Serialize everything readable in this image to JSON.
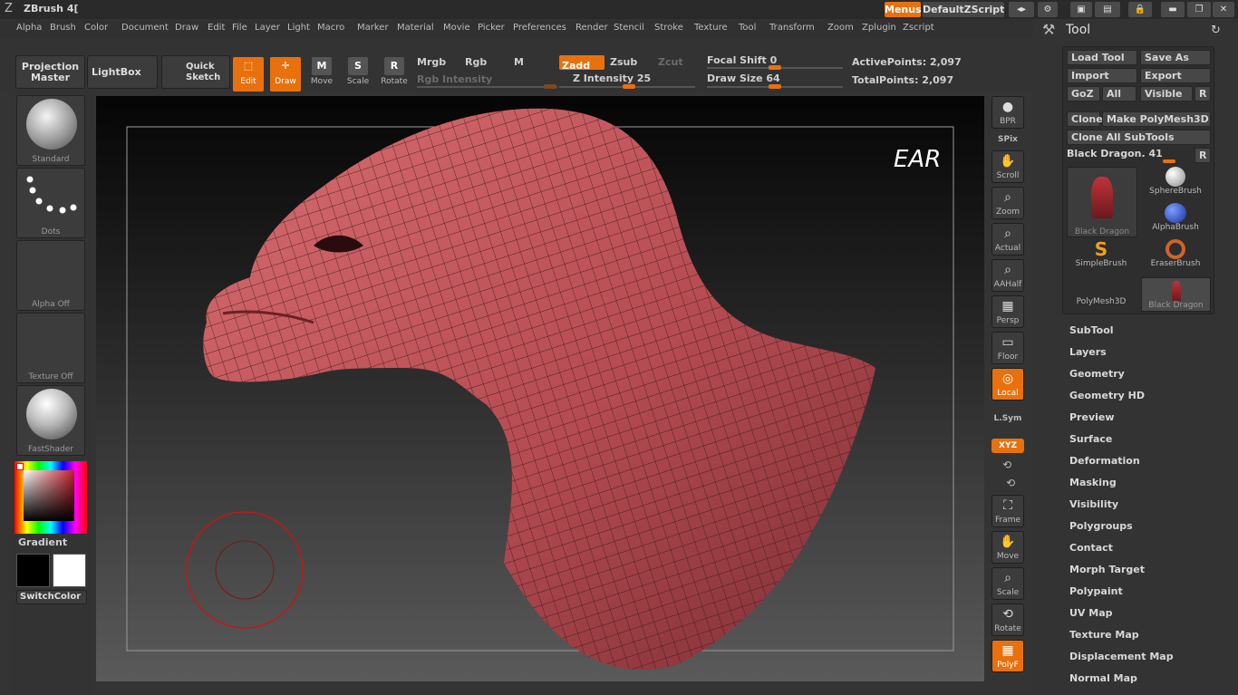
{
  "app": {
    "title": "ZBrush 4[",
    "menus_label": "Menus",
    "script_name": "DefaultZScript"
  },
  "menubar": [
    "Alpha",
    "Brush",
    "Color",
    "Document",
    "Draw",
    "Edit",
    "File",
    "Layer",
    "Light",
    "Macro",
    "Marker",
    "Material",
    "Movie",
    "Picker",
    "Preferences",
    "Render",
    "Stencil",
    "Stroke",
    "Texture",
    "Tool",
    "Transform",
    "Zoom",
    "Zplugin",
    "Zscript"
  ],
  "toolbar": {
    "projection_master": "Projection Master",
    "lightbox": "LightBox",
    "quick_sketch": "Quick Sketch",
    "edit": "Edit",
    "draw": "Draw",
    "move": "Move",
    "scale": "Scale",
    "rotate": "Rotate",
    "mrgb": "Mrgb",
    "rgb": "Rgb",
    "m": "M",
    "rgb_intensity": "Rgb Intensity",
    "zadd": "Zadd",
    "zsub": "Zsub",
    "zcut": "Zcut",
    "z_intensity_label": "Z Intensity",
    "z_intensity_value": "25",
    "focal_shift_label": "Focal Shift",
    "focal_shift_value": "0",
    "draw_size_label": "Draw Size",
    "draw_size_value": "64",
    "active_points": "ActivePoints: 2,097",
    "total_points": "TotalPoints: 2,097"
  },
  "left_shelf": {
    "brush": "Standard",
    "stroke": "Dots",
    "alpha": "Alpha Off",
    "texture": "Texture Off",
    "material": "FastShader",
    "gradient": "Gradient",
    "switch_color": "SwitchColor",
    "colors": {
      "main": "#000000",
      "secondary": "#ffffff",
      "picker_base": "#c0202a"
    }
  },
  "canvas": {
    "mesh_color": "#c35b5e",
    "signature": "EAR"
  },
  "right_shelf": [
    {
      "name": "bpr",
      "label": "BPR"
    },
    {
      "name": "spix",
      "label": "SPix"
    },
    {
      "name": "scroll",
      "label": "Scroll"
    },
    {
      "name": "zoom",
      "label": "Zoom"
    },
    {
      "name": "actual",
      "label": "Actual"
    },
    {
      "name": "aahalf",
      "label": "AAHalf"
    },
    {
      "name": "persp",
      "label": "Persp"
    },
    {
      "name": "floor",
      "label": "Floor"
    },
    {
      "name": "local",
      "label": "Local"
    },
    {
      "name": "lsym",
      "label": "L.Sym"
    },
    {
      "name": "xyz",
      "label": "XYZ"
    },
    {
      "name": "frame",
      "label": "Frame"
    },
    {
      "name": "move",
      "label": "Move"
    },
    {
      "name": "scale",
      "label": "Scale"
    },
    {
      "name": "rotate",
      "label": "Rotate"
    },
    {
      "name": "polyf",
      "label": "PolyF"
    }
  ],
  "tool_palette": {
    "title": "Tool",
    "load_tool": "Load Tool",
    "save_as": "Save As",
    "import": "Import",
    "export": "Export",
    "goz": "GoZ",
    "all": "All",
    "visible": "Visible",
    "r": "R",
    "clone": "Clone",
    "make_polymesh": "Make PolyMesh3D",
    "clone_all": "Clone All SubTools",
    "current_tool": "Black Dragon. 41",
    "subtools": [
      "Black Dragon",
      "SphereBrush",
      "AlphaBrush",
      "SimpleBrush",
      "EraserBrush",
      "PolyMesh3D",
      "Black Dragon"
    ],
    "sections": [
      "SubTool",
      "Layers",
      "Geometry",
      "Geometry HD",
      "Preview",
      "Surface",
      "Deformation",
      "Masking",
      "Visibility",
      "Polygroups",
      "Contact",
      "Morph Target",
      "Polypaint",
      "UV Map",
      "Texture Map",
      "Displacement Map",
      "Normal Map"
    ]
  }
}
